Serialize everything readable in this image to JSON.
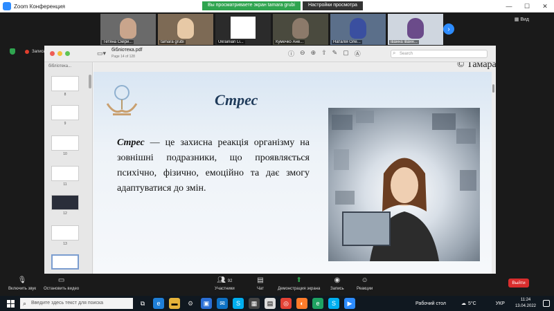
{
  "window": {
    "title": "Zoom Конференция",
    "viewing_banner": "Вы просматриваете экран tamara grubi",
    "view_options": "Настройки просмотра",
    "view_button": "Вид"
  },
  "participants": [
    {
      "name": "Тетяна Сміри..."
    },
    {
      "name": "tamara grubi"
    },
    {
      "name": "Ukrainian Li..."
    },
    {
      "name": "Кумечко Ане..."
    },
    {
      "name": "Наталія Оле..."
    },
    {
      "name": "іванна іванн..."
    }
  ],
  "recording": {
    "label": "Запись"
  },
  "pdf": {
    "title": "бібліотека.pdf",
    "subtitle": "Page 14 of 128",
    "search_placeholder": "Search",
    "sidebar_title": "бібліотека...",
    "page_numbers": [
      "8",
      "9",
      "10",
      "11",
      "12",
      "13"
    ]
  },
  "slide": {
    "copyright": "© Тамара Грубі",
    "title": "Стрес",
    "term": "Стрес",
    "body": " — це захисна реакція організму на зовнішні подразники, що проявляється психічно, фізично, емоційно та дає змогу адаптуватися до змін."
  },
  "zoom_controls": {
    "audio": "Включить звук",
    "video": "Остановить видео",
    "participants": "Участники",
    "participants_count": "92",
    "chat": "Чат",
    "share": "Демонстрация экрана",
    "record": "Запись",
    "reactions": "Реакции",
    "leave": "Выйти"
  },
  "taskbar": {
    "search_placeholder": "Введите здесь текст для поиска",
    "desktop_label": "Рабочий стол",
    "temperature": "5°C",
    "language": "УКР",
    "time": "11:24",
    "date": "13.04.2022"
  }
}
